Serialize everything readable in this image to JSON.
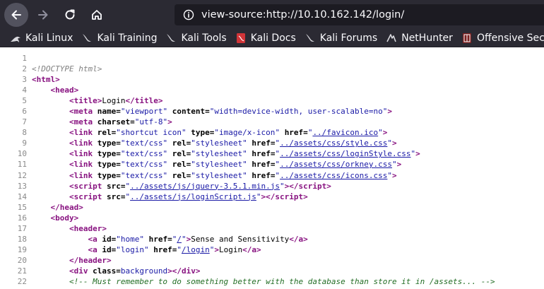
{
  "browser": {
    "url": "view-source:http://10.10.162.142/login/"
  },
  "bookmarks": [
    {
      "label": "Kali Linux",
      "icon": "kali-dragon-icon"
    },
    {
      "label": "Kali Training",
      "icon": "kali-dragon-icon"
    },
    {
      "label": "Kali Tools",
      "icon": "kali-dragon-icon"
    },
    {
      "label": "Kali Docs",
      "icon": "kali-docs-icon"
    },
    {
      "label": "Kali Forums",
      "icon": "kali-dragon-icon"
    },
    {
      "label": "NetHunter",
      "icon": "nethunter-icon"
    },
    {
      "label": "Offensive Security",
      "icon": "offsec-icon"
    }
  ],
  "source": {
    "line_numbers": [
      "1",
      "2",
      "3",
      "4",
      "5",
      "6",
      "7",
      "8",
      "9",
      "10",
      "11",
      "12",
      "13",
      "14",
      "15",
      "16",
      "17",
      "18",
      "19",
      "20",
      "21",
      "22"
    ],
    "doctype": "<!DOCTYPE html>",
    "title_text": "Login",
    "meta_viewport": "width=device-width, user-scalable=no",
    "meta_charset": "utf-8",
    "favicon_type": "image/x-icon",
    "favicon_href": "../favicon.ico",
    "stylesheets": [
      "../assets/css/style.css",
      "../assets/css/loginStyle.css",
      "../assets/css/orkney.css",
      "../assets/css/icons.css"
    ],
    "scripts": [
      "../assets/js/jquery-3.5.1.min.js",
      "../assets/js/loginScript.js"
    ],
    "link_home_href": "/",
    "link_home_text": "Sense and Sensitivity",
    "link_login_href": "/login",
    "link_login_text": "Login",
    "comment": "<!-- Must remember to do something better with the database than store it in /assets... -->"
  }
}
